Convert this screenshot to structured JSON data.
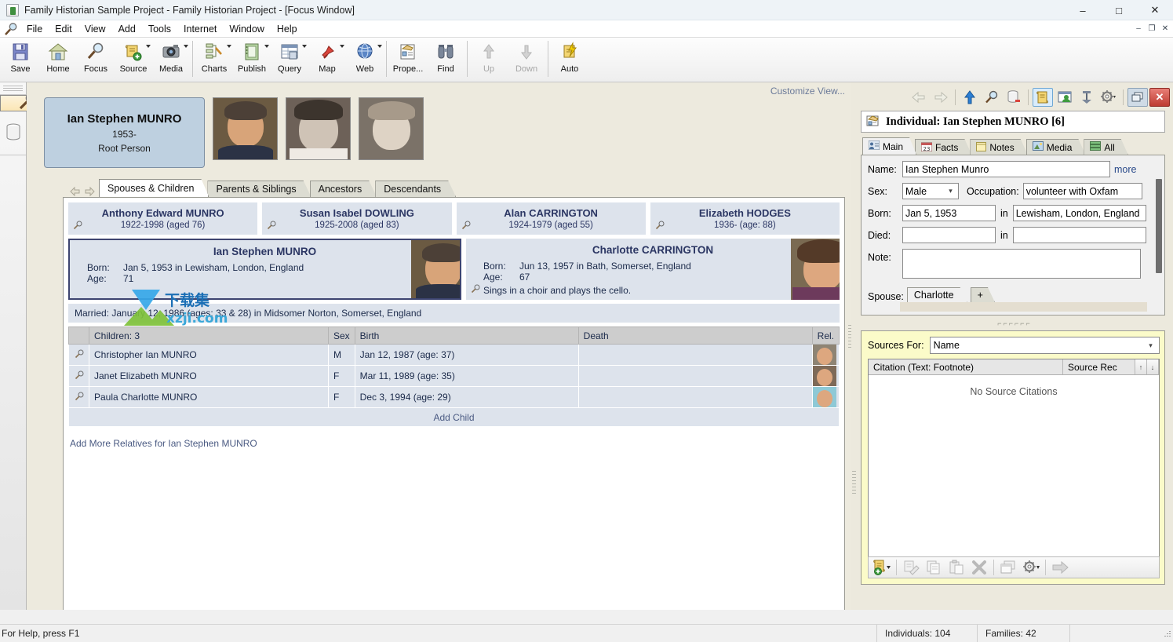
{
  "window": {
    "title": "Family Historian Sample Project - Family Historian Project - [Focus Window]",
    "app_icon": "family-historian-icon",
    "minimize": "–",
    "maximize": "□",
    "close": "✕",
    "mdi_minimize": "–",
    "mdi_restore": "❐",
    "mdi_close": "✕"
  },
  "menubar": {
    "items": [
      "File",
      "Edit",
      "View",
      "Add",
      "Tools",
      "Internet",
      "Window",
      "Help"
    ]
  },
  "toolbar": {
    "buttons": [
      {
        "label": "Save",
        "icon": "floppy-disk-icon",
        "dropdown": false,
        "disabled": false
      },
      {
        "label": "Home",
        "icon": "house-icon",
        "dropdown": false,
        "disabled": false
      },
      {
        "label": "Focus",
        "icon": "magnifier-icon",
        "dropdown": false,
        "disabled": false
      },
      {
        "label": "Source",
        "icon": "scroll-add-icon",
        "dropdown": true,
        "disabled": false
      },
      {
        "label": "Media",
        "icon": "camera-icon",
        "dropdown": true,
        "disabled": false
      },
      {
        "label": "Charts",
        "icon": "chart-pencil-icon",
        "dropdown": true,
        "disabled": false
      },
      {
        "label": "Publish",
        "icon": "book-icon",
        "dropdown": true,
        "disabled": false
      },
      {
        "label": "Query",
        "icon": "table-query-icon",
        "dropdown": true,
        "disabled": false
      },
      {
        "label": "Map",
        "icon": "pushpin-icon",
        "dropdown": true,
        "disabled": false
      },
      {
        "label": "Web",
        "icon": "globe-icon",
        "dropdown": true,
        "disabled": false
      },
      {
        "label": "Prope...",
        "icon": "properties-icon",
        "dropdown": false,
        "disabled": false
      },
      {
        "label": "Find",
        "icon": "binoculars-icon",
        "dropdown": false,
        "disabled": false
      },
      {
        "label": "Up",
        "icon": "arrow-up-icon",
        "dropdown": false,
        "disabled": true
      },
      {
        "label": "Down",
        "icon": "arrow-down-icon",
        "dropdown": false,
        "disabled": true
      },
      {
        "label": "Auto",
        "icon": "auto-scroll-icon",
        "dropdown": false,
        "disabled": false
      }
    ]
  },
  "rail": {
    "items": [
      {
        "icon": "magnifier-icon",
        "name": "focus-rail",
        "selected": true
      },
      {
        "icon": "database-icon",
        "name": "records-rail",
        "selected": false
      }
    ]
  },
  "focus_window": {
    "customize_link": "Customize View...",
    "root_person": {
      "name": "Ian Stephen MUNRO",
      "years": "1953-",
      "role": "Root Person"
    },
    "thumbnails": [
      "portrait-ian-adult",
      "portrait-ian-child-1",
      "portrait-ian-child-2"
    ],
    "nav_back": "back-arrow-icon",
    "nav_forward": "forward-arrow-icon",
    "tabs": [
      {
        "label": "Spouses & Children",
        "active": true
      },
      {
        "label": "Parents & Siblings",
        "active": false
      },
      {
        "label": "Ancestors",
        "active": false
      },
      {
        "label": "Descendants",
        "active": false
      }
    ],
    "parents": [
      {
        "name": "Anthony Edward MUNRO",
        "dates": "1922-1998 (aged 76)"
      },
      {
        "name": "Susan Isabel DOWLING",
        "dates": "1925-2008 (aged 83)"
      },
      {
        "name": "Alan CARRINGTON",
        "dates": "1924-1979 (aged 55)"
      },
      {
        "name": "Elizabeth HODGES",
        "dates": "1936-  (age: 88)"
      }
    ],
    "subject": {
      "name": "Ian Stephen MUNRO",
      "born_label": "Born:",
      "born_value": "Jan 5, 1953 in Lewisham, London, England",
      "age_label": "Age:",
      "age_value": "71"
    },
    "partner": {
      "name": "Charlotte CARRINGTON",
      "born_label": "Born:",
      "born_value": "Jun 13, 1957 in Bath, Somerset, England",
      "age_label": "Age:",
      "age_value": "67",
      "note": "Sings in a choir and plays the cello."
    },
    "marriage": "Married: January 12, 1986 (ages: 33 & 28) in Midsomer Norton, Somerset, England",
    "children_table": {
      "headers": [
        "Children: 3",
        "Sex",
        "Birth",
        "Death",
        "Rel."
      ],
      "rows": [
        {
          "name": "Christopher Ian MUNRO",
          "sex": "M",
          "birth": "Jan 12, 1987 (age: 37)",
          "death": "",
          "photo": "portrait-christopher"
        },
        {
          "name": "Janet Elizabeth MUNRO",
          "sex": "F",
          "birth": "Mar 11, 1989 (age: 35)",
          "death": "",
          "photo": "portrait-janet"
        },
        {
          "name": "Paula Charlotte MUNRO",
          "sex": "F",
          "birth": "Dec 3, 1994 (age: 29)",
          "death": "",
          "photo": "portrait-paula"
        }
      ],
      "add_child": "Add Child"
    },
    "add_more_relatives": "Add More Relatives for Ian Stephen MUNRO"
  },
  "property_box": {
    "toolbar": [
      {
        "icon": "back-arrow-icon",
        "disabled": true
      },
      {
        "icon": "forward-arrow-icon",
        "disabled": true
      },
      {
        "icon": "arrow-up-blue-icon",
        "disabled": false
      },
      {
        "icon": "magnifier-icon",
        "disabled": false
      },
      {
        "icon": "database-delete-icon",
        "disabled": false
      },
      {
        "icon": "scroll-sources-icon",
        "disabled": false,
        "active": true
      },
      {
        "icon": "window-person-icon",
        "disabled": false
      },
      {
        "icon": "pushpin-icon",
        "disabled": false
      },
      {
        "icon": "gear-icon",
        "disabled": false,
        "dropdown": true
      },
      {
        "icon": "restore-window-icon",
        "disabled": false
      },
      {
        "icon": "close-icon",
        "disabled": false
      }
    ],
    "record_title": "Individual: Ian Stephen MUNRO [6]",
    "record_icon": "individual-record-icon",
    "tabs": [
      {
        "label": "Main",
        "icon": "person-card-icon",
        "active": true
      },
      {
        "label": "Facts",
        "icon": "calendar-23-icon",
        "active": false
      },
      {
        "label": "Notes",
        "icon": "note-icon",
        "active": false
      },
      {
        "label": "Media",
        "icon": "image-icon",
        "active": false
      },
      {
        "label": "All",
        "icon": "layers-icon",
        "active": false
      }
    ],
    "fields": {
      "name_label": "Name:",
      "name_value": "Ian Stephen Munro",
      "more_link": "more",
      "sex_label": "Sex:",
      "sex_value": "Male",
      "occupation_label": "Occupation:",
      "occupation_value": "volunteer with Oxfam",
      "born_label": "Born:",
      "born_value": "Jan 5, 1953",
      "born_in_label": "in",
      "born_place": "Lewisham, London, England",
      "died_label": "Died:",
      "died_value": "",
      "died_in_label": "in",
      "died_place": "",
      "note_label": "Note:",
      "note_value": "",
      "spouse_label": "Spouse:",
      "spouse_tab": "Charlotte",
      "spouse_add": "+"
    }
  },
  "sources_panel": {
    "sources_for_label": "Sources For:",
    "sources_for_value": "Name",
    "columns": [
      "Citation (Text: Footnote)",
      "Source Rec"
    ],
    "sort_up": "↑",
    "sort_down": "↓",
    "empty_message": "No Source Citations",
    "buttons": [
      {
        "icon": "add-citation-icon",
        "dropdown": true
      },
      {
        "icon": "edit-citation-icon",
        "dropdown": false
      },
      {
        "icon": "copy-icon",
        "dropdown": false
      },
      {
        "icon": "paste-icon",
        "dropdown": false
      },
      {
        "icon": "delete-x-icon",
        "dropdown": false
      },
      {
        "icon": "duplicate-window-icon",
        "dropdown": false
      },
      {
        "icon": "gear-icon",
        "dropdown": true
      },
      {
        "icon": "go-arrow-icon",
        "dropdown": false
      }
    ]
  },
  "statusbar": {
    "hint": "For Help, press F1",
    "individuals": "Individuals: 104",
    "families": "Families: 42",
    "extra": ""
  },
  "watermark": {
    "text_cn": "下载集",
    "text_url": "xzji.com"
  },
  "colors": {
    "desk": "#edeade",
    "card": "#dde3ec",
    "card_text": "#2b3663",
    "root_box": "#bed0e0",
    "subject_border": "#3d4470",
    "source_panel": "#fbfbc9",
    "link": "#4a5a82"
  }
}
